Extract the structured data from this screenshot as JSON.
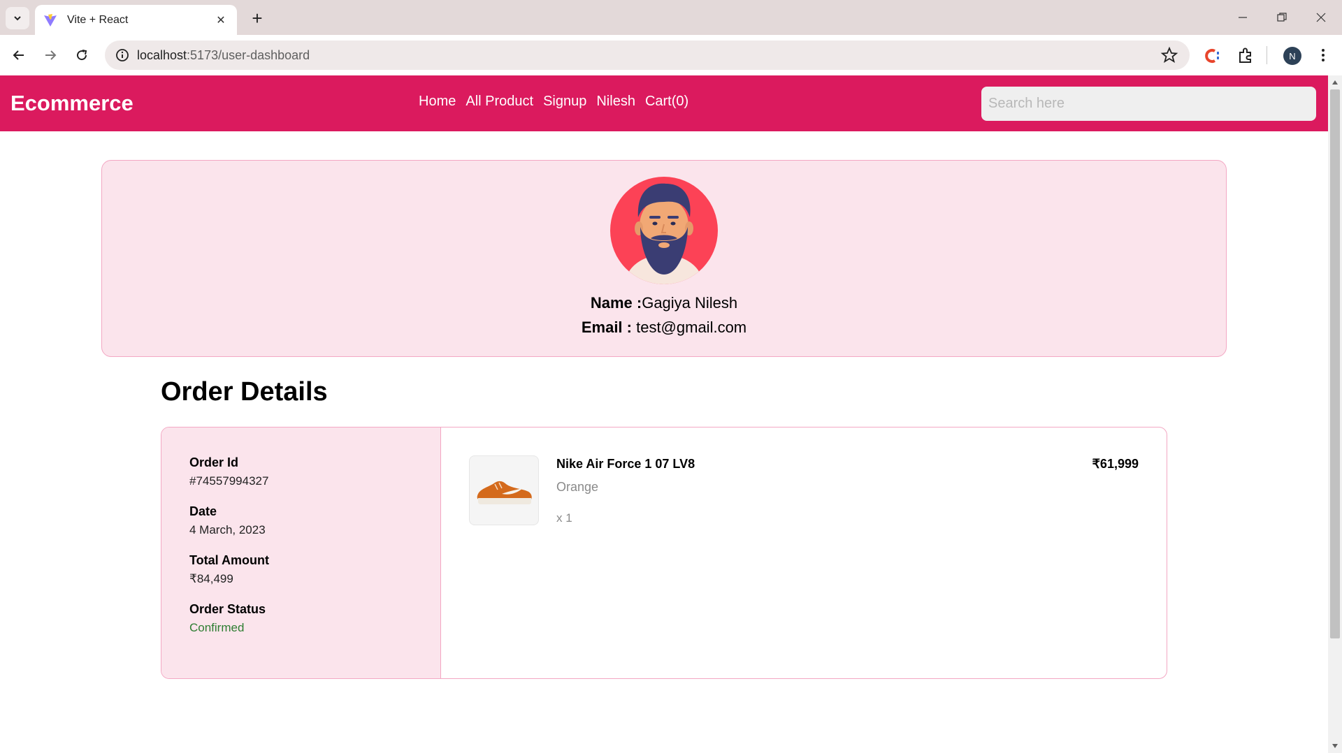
{
  "browser": {
    "tab_title": "Vite + React",
    "url_host": "localhost",
    "url_path": ":5173/user-dashboard",
    "profile_initial": "N"
  },
  "navbar": {
    "brand": "Ecommerce",
    "links": [
      "Home",
      "All Product",
      "Signup",
      "Nilesh",
      "Cart(0)"
    ],
    "search_placeholder": "Search here",
    "color": "#db1a5e"
  },
  "profile": {
    "name_label": "Name :",
    "name_value": "Gagiya Nilesh",
    "email_label": "Email : ",
    "email_value": "test@gmail.com"
  },
  "orders": {
    "heading": "Order Details",
    "order_id_label": "Order Id",
    "order_id_value": "#74557994327",
    "date_label": "Date",
    "date_value": "4 March, 2023",
    "total_label": "Total Amount",
    "total_value": "₹84,499",
    "status_label": "Order Status",
    "status_value": "Confirmed",
    "item": {
      "name": "Nike Air Force 1 07 LV8",
      "color": "Orange",
      "qty": "x 1",
      "price": "₹61,999"
    }
  },
  "colors": {
    "accent": "#db1a5e",
    "card_bg": "#fbe4ec",
    "card_border": "#f3a7c3",
    "status": "#2e7d32"
  }
}
